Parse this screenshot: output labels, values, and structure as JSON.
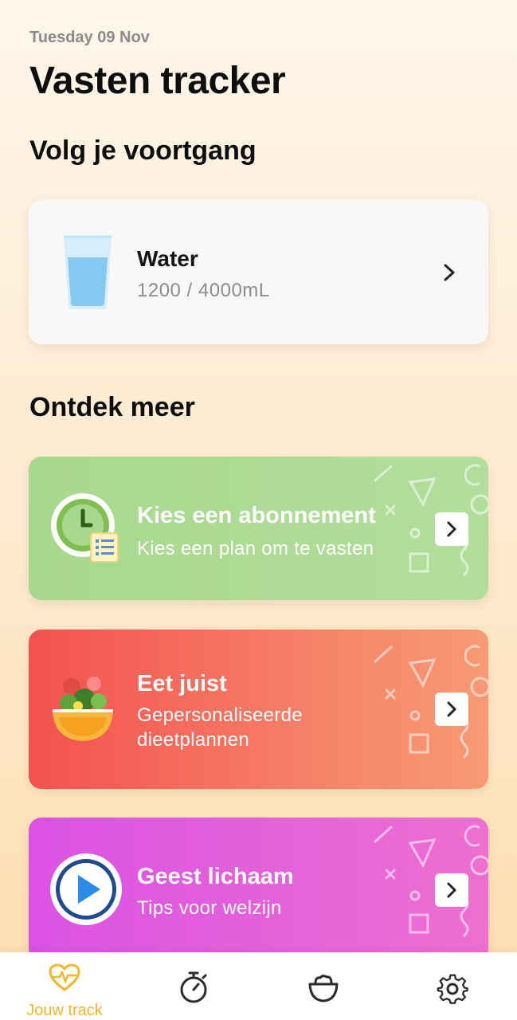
{
  "header": {
    "date": "Tuesday 09 Nov",
    "title": "Vasten tracker"
  },
  "sections": {
    "progress_title": "Volg je voortgang",
    "discover_title": "Ontdek meer"
  },
  "water": {
    "label": "Water",
    "value": "1200 / 4000mL",
    "icon": "water-glass-icon"
  },
  "promos": [
    {
      "title": "Kies een abonnement",
      "subtitle": "Kies een plan om te vasten",
      "icon": "clock-plan-icon",
      "color": "#A8D88D"
    },
    {
      "title": "Eet juist",
      "subtitle": "Gepersonaliseerde dieetplannen",
      "icon": "salad-bowl-icon",
      "color": "#F4514F"
    },
    {
      "title": "Geest lichaam",
      "subtitle": "Tips voor welzijn",
      "icon": "play-icon",
      "color": "#DB52E4"
    }
  ],
  "nav": {
    "items": [
      {
        "label": "Jouw track",
        "icon": "heart-pulse-icon",
        "active": true
      },
      {
        "icon": "stopwatch-icon"
      },
      {
        "icon": "bowl-icon"
      },
      {
        "icon": "gear-icon"
      }
    ],
    "active_color": "#F0B728",
    "inactive_color": "#2B2B2B"
  }
}
